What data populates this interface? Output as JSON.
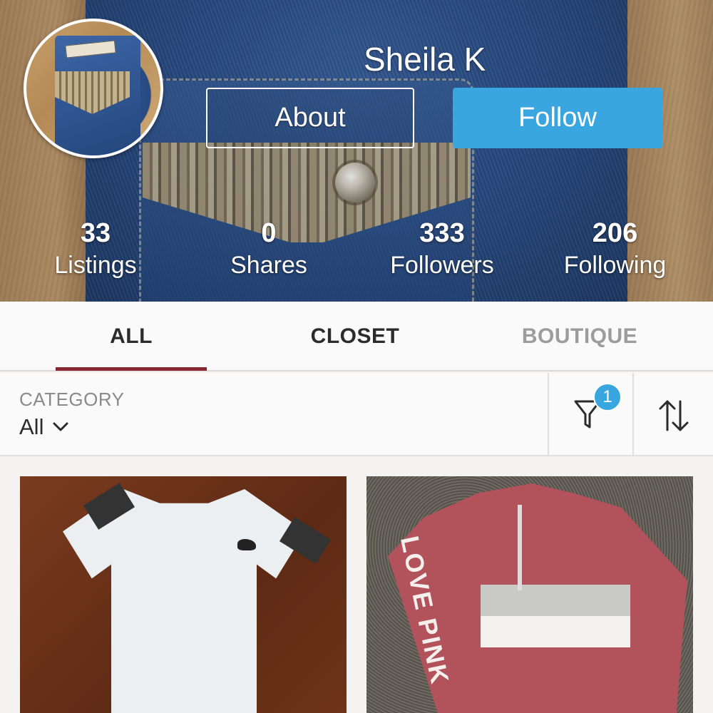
{
  "profile": {
    "username": "Sheila K",
    "about_label": "About",
    "follow_label": "Follow",
    "stats": [
      {
        "value": "33",
        "label": "Listings"
      },
      {
        "value": "0",
        "label": "Shares"
      },
      {
        "value": "333",
        "label": "Followers"
      },
      {
        "value": "206",
        "label": "Following"
      }
    ]
  },
  "tabs": [
    {
      "label": "ALL",
      "active": true
    },
    {
      "label": "CLOSET",
      "active": false
    },
    {
      "label": "BOUTIQUE",
      "active": false
    }
  ],
  "filters": {
    "category_label": "CATEGORY",
    "category_value": "All",
    "filter_count": "1",
    "icons": [
      "chevron-down-icon",
      "filter-funnel-icon",
      "sort-arrows-icon"
    ]
  },
  "listings": [
    {
      "image": "white-tee-photo",
      "sleeve_text": ""
    },
    {
      "image": "pink-quarter-zip-photo",
      "sleeve_text": "LOVE PINK"
    }
  ],
  "colors": {
    "accent_blue": "#3aa6e0",
    "tab_underline": "#8b2633",
    "inactive_tab": "#9c9c9c"
  }
}
